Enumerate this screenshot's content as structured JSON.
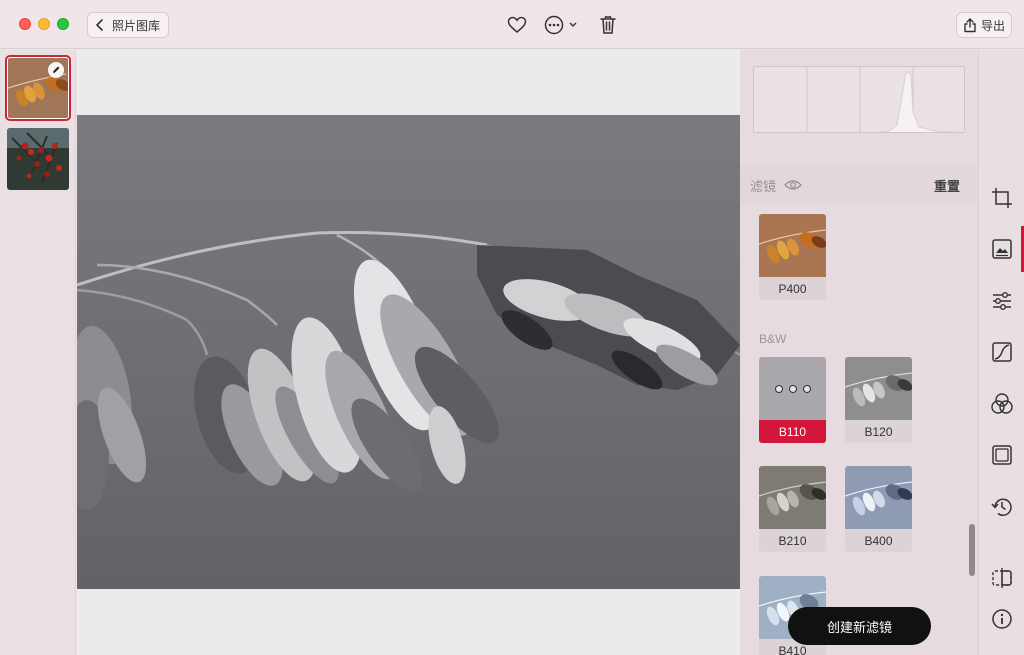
{
  "titlebar": {
    "back_label": "照片图库",
    "export_label": "导出",
    "icons": [
      "back-chevron-icon",
      "heart-icon",
      "more-icon",
      "trash-icon",
      "share-icon"
    ]
  },
  "thumbnails": [
    {
      "name": "dried-grass-thumb",
      "selected": true,
      "edited": true
    },
    {
      "name": "red-berries-thumb",
      "selected": false,
      "edited": false
    }
  ],
  "panel": {
    "filter_title": "滤镜",
    "reset_label": "重置",
    "section_bw": "B&W",
    "filters": [
      {
        "label": "P400",
        "active": false
      },
      {
        "label": "B110",
        "active": true
      },
      {
        "label": "B120",
        "active": false
      },
      {
        "label": "B210",
        "active": false
      },
      {
        "label": "B400",
        "active": false
      },
      {
        "label": "B410",
        "active": false
      }
    ],
    "create_label": "创建新滤镜"
  },
  "rail": {
    "icons": [
      "crop-icon",
      "filter-icon",
      "adjust-icon",
      "curves-icon",
      "color-mix-icon",
      "vignette-icon",
      "history-icon",
      "compare-icon",
      "info-icon"
    ],
    "active": "filter-icon"
  },
  "colors": {
    "accent": "#d3163a",
    "titlebar": "#f0e6e9",
    "panel": "#e6dcdf"
  }
}
